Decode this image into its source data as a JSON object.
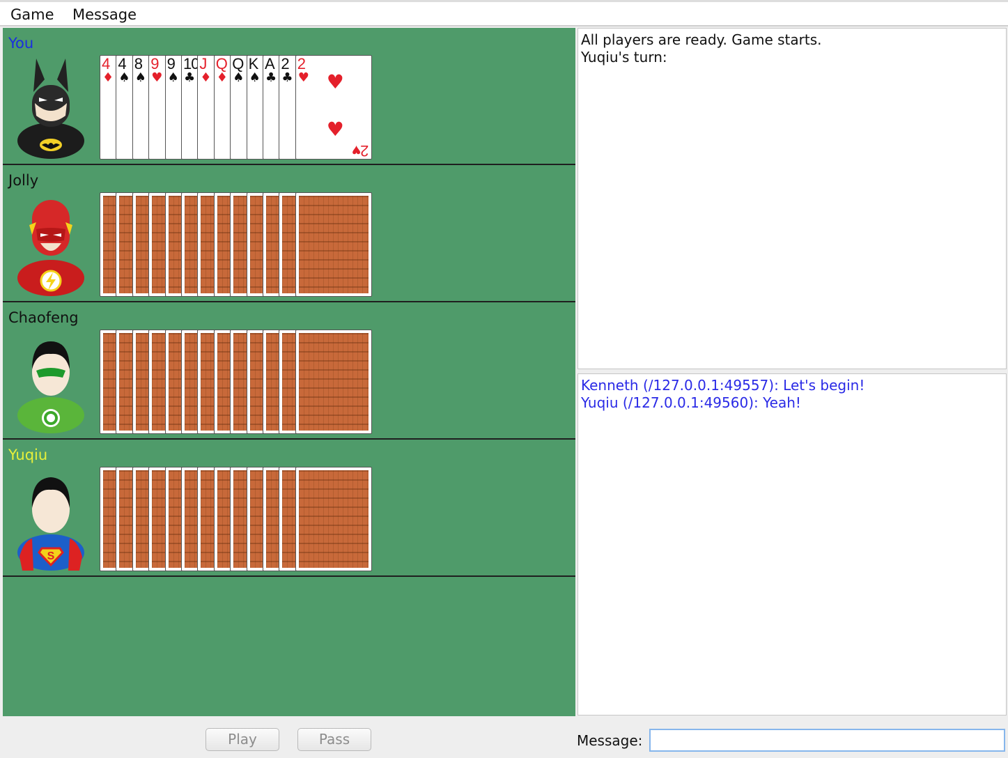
{
  "menu": {
    "items": [
      "Game",
      "Message"
    ]
  },
  "players": [
    {
      "name": "You",
      "name_color": "#1a2ee0",
      "avatar": "batman-avatar",
      "hand_visible": true
    },
    {
      "name": "Jolly",
      "name_color": "#111111",
      "avatar": "flash-avatar",
      "hand_visible": false
    },
    {
      "name": "Chaofeng",
      "name_color": "#111111",
      "avatar": "green-lantern-avatar",
      "hand_visible": false
    },
    {
      "name": "Yuqiu",
      "name_color": "#e6f03a",
      "avatar": "superman-avatar",
      "hand_visible": false
    }
  ],
  "my_hand": [
    {
      "rank": "4",
      "suit": "♦",
      "color": "red"
    },
    {
      "rank": "4",
      "suit": "♠",
      "color": "black"
    },
    {
      "rank": "8",
      "suit": "♠",
      "color": "black"
    },
    {
      "rank": "9",
      "suit": "♥",
      "color": "red"
    },
    {
      "rank": "9",
      "suit": "♠",
      "color": "black"
    },
    {
      "rank": "10",
      "suit": "♣",
      "color": "black"
    },
    {
      "rank": "J",
      "suit": "♦",
      "color": "red"
    },
    {
      "rank": "Q",
      "suit": "♦",
      "color": "red"
    },
    {
      "rank": "Q",
      "suit": "♠",
      "color": "black"
    },
    {
      "rank": "K",
      "suit": "♠",
      "color": "black"
    },
    {
      "rank": "A",
      "suit": "♣",
      "color": "black"
    },
    {
      "rank": "2",
      "suit": "♣",
      "color": "black"
    },
    {
      "rank": "2",
      "suit": "♥",
      "color": "red"
    }
  ],
  "opponent_card_count": 13,
  "game_log": [
    "All players are ready. Game starts.",
    "Yuqiu's turn:"
  ],
  "chat_log": [
    "Kenneth (/127.0.0.1:49557): Let's begin!",
    "Yuqiu (/127.0.0.1:49560): Yeah!"
  ],
  "controls": {
    "play_label": "Play",
    "pass_label": "Pass",
    "message_label": "Message:",
    "message_value": ""
  },
  "colors": {
    "table": "#4f9b6a",
    "card_back": "#c8693a",
    "chat_text": "#2a2ae6"
  }
}
